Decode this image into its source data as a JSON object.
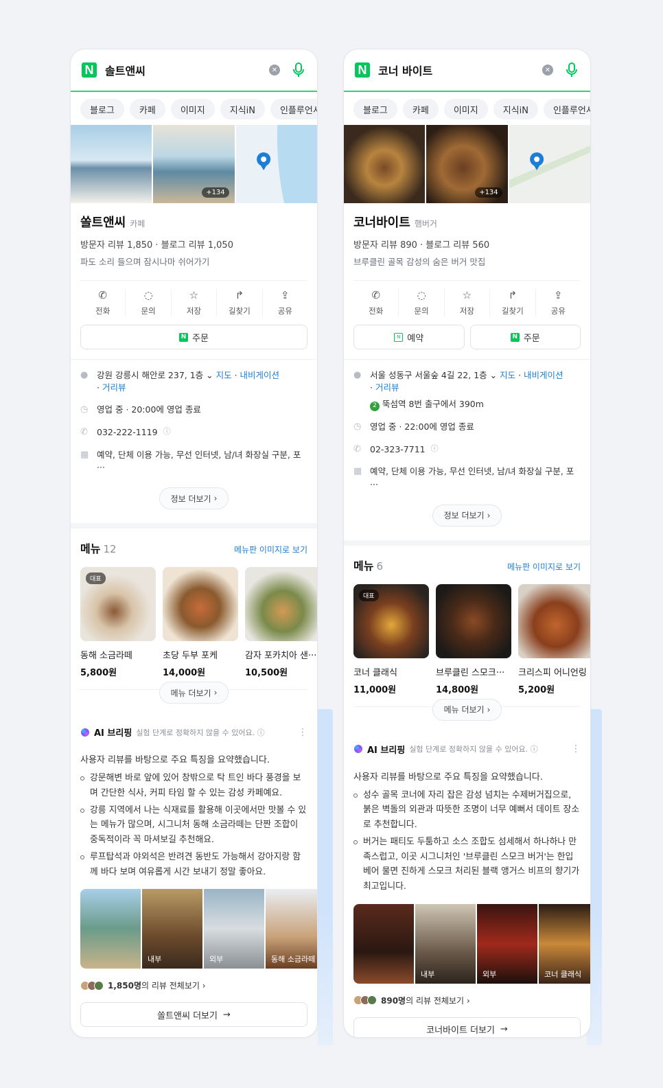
{
  "tabs": [
    "블로그",
    "카페",
    "이미지",
    "지식iN",
    "인플루언서"
  ],
  "cards": [
    {
      "query": "솔트앤씨",
      "photo_count": "+134",
      "place_name": "쏠트앤씨",
      "category": "카페",
      "reviews": "방문자 리뷰 1,850 · 블로그 리뷰 1,050",
      "description": "파도 소리 들으며 잠시나마 쉬어가기",
      "actions": [
        "전화",
        "문의",
        "저장",
        "길찾기",
        "공유"
      ],
      "orders": [
        "주문"
      ],
      "address": "강원 강릉시 해안로 237, 1층",
      "map_link": "지도",
      "nav_link": "내비게이션",
      "distance_link": "거리뷰",
      "subway": "",
      "hours": "영업 중 · 20:00에 영업 종료",
      "phone": "032-222-1119",
      "amenities": "예약, 단체 이용 가능, 무선 인터넷, 남/녀 화장실 구분, 포···",
      "info_more": "정보 더보기",
      "menu_title": "메뉴",
      "menu_count": "12",
      "menu_link": "메뉴판 이미지로 보기",
      "rep_badge": "대표",
      "menu": [
        {
          "name": "동해 소금라떼",
          "price": "5,800원"
        },
        {
          "name": "초당 두부 포케",
          "price": "14,000원"
        },
        {
          "name": "감자 포카치아 샌···",
          "price": "10,500원"
        }
      ],
      "menu_more": "메뉴 더보기",
      "ai_title": "AI 브리핑",
      "ai_note": "실험 단계로 정확하지 않을 수 있어요.",
      "ai_summary": "사용자 리뷰를 바탕으로 주요 특징을 요약했습니다.",
      "ai_points": [
        "강문해변 바로 앞에 있어 창밖으로 탁 트인 바다 풍경을 보며 간단한 식사, 커피 타임 할 수 있는 감성 카페예요.",
        "강릉 지역에서 나는 식재료를 활용해 이곳에서만 맛볼 수 있는 메뉴가 많으며, 시그니처 동해 소금라떼는 단짠 조합이 중독적이라 꼭 마셔보길 추천해요.",
        "루프탑석과 야외석은 반려견 동반도 가능해서 강아지랑 함께 바다 보며 여유롭게 시간 보내기 정말 좋아요."
      ],
      "ai_photos": [
        "",
        "내부",
        "외부",
        "동해 소금라떼"
      ],
      "review_count": "1,850명",
      "review_suffix": "의 리뷰 전체보기",
      "more_button": "쏠트앤씨 더보기"
    },
    {
      "query": "코너 바이트",
      "photo_count": "+134",
      "place_name": "코너바이트",
      "category": "햄버거",
      "reviews": "방문자 리뷰 890 · 블로그 리뷰 560",
      "description": "브루클린 골목 감성의 숨은 버거 맛집",
      "actions": [
        "전화",
        "문의",
        "저장",
        "길찾기",
        "공유"
      ],
      "orders": [
        "예약",
        "주문"
      ],
      "address": "서울 성동구 서울숲 4길 22, 1층",
      "map_link": "지도",
      "nav_link": "내비게이션",
      "distance_link": "거리뷰",
      "subway": "뚝섬역 8번 출구에서 390m",
      "subway_line": "2",
      "hours": "영업 중 · 22:00에 영업 종료",
      "phone": "02-323-7711",
      "amenities": "예약, 단체 이용 가능, 무선 인터넷, 남/녀 화장실 구분, 포···",
      "info_more": "정보 더보기",
      "menu_title": "메뉴",
      "menu_count": "6",
      "menu_link": "메뉴판 이미지로 보기",
      "rep_badge": "대표",
      "menu": [
        {
          "name": "코너 클래식",
          "price": "11,000원"
        },
        {
          "name": "브루클린 스모크···",
          "price": "14,800원"
        },
        {
          "name": "크리스피 어니언링",
          "price": "5,200원"
        }
      ],
      "menu_more": "메뉴 더보기",
      "ai_title": "AI 브리핑",
      "ai_note": "실험 단계로 정확하지 않을 수 있어요.",
      "ai_summary": "사용자 리뷰를 바탕으로 주요 특징을 요약했습니다.",
      "ai_points": [
        "성수 골목 코너에 자리 잡은 감성 넘치는 수제버거집으로, 붉은 벽돌의 외관과 따뜻한 조명이 너무 예뻐서 데이트 장소로 추천합니다.",
        "버거는 패티도 두툼하고 소스 조합도 섬세해서 하나하나 만족스럽고, 이곳 시그니처인 '브루클린 스모크 버거'는 한입 베어 물면 진하게 스모크 처리된 블랙 앵거스 비프의 향기가 최고입니다."
      ],
      "ai_photos": [
        "",
        "내부",
        "외부",
        "코너 클래식"
      ],
      "review_count": "890명",
      "review_suffix": "의 리뷰 전체보기",
      "more_button": "코너바이트 더보기"
    }
  ],
  "colors": {
    "naver_green": "#03c75a",
    "link_blue": "#1c7ed6",
    "background": "#f1f3f7"
  },
  "icons": [
    "naver-logo-icon",
    "clear-icon",
    "mic-icon",
    "phone-icon",
    "chat-icon",
    "star-icon",
    "directions-icon",
    "share-icon",
    "pin-icon",
    "clock-icon",
    "building-icon",
    "info-icon",
    "ai-sparkle-icon",
    "kebab-icon",
    "arrow-right-icon",
    "chevron-right-icon"
  ]
}
